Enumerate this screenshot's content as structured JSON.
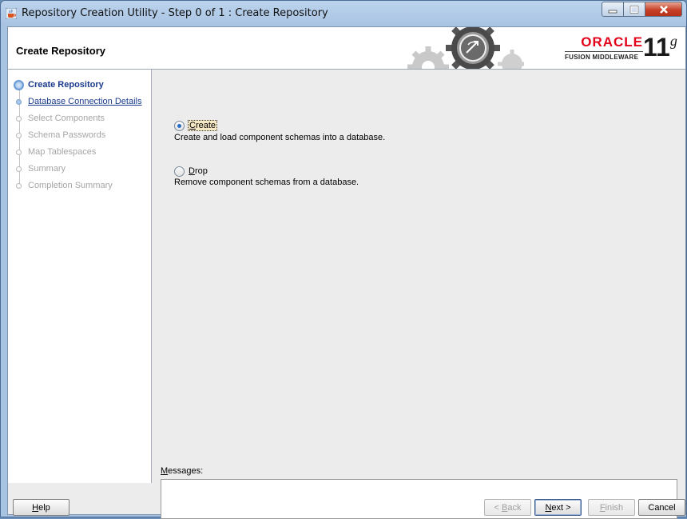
{
  "window": {
    "title": "Repository Creation Utility - Step 0 of 1 : Create Repository",
    "icon": "java-cup-icon"
  },
  "header": {
    "title": "Create Repository",
    "brand": {
      "oracle": "ORACLE",
      "product": "FUSION MIDDLEWARE",
      "version_number": "11",
      "version_letter": "g"
    }
  },
  "nav": {
    "items": [
      {
        "label": "Create Repository",
        "state": "current"
      },
      {
        "label": "Database Connection Details",
        "state": "link"
      },
      {
        "label": "Select Components",
        "state": "disabled"
      },
      {
        "label": "Schema Passwords",
        "state": "disabled"
      },
      {
        "label": "Map Tablespaces",
        "state": "disabled"
      },
      {
        "label": "Summary",
        "state": "disabled"
      },
      {
        "label": "Completion Summary",
        "state": "disabled"
      }
    ]
  },
  "options": {
    "create": {
      "label": "Create",
      "mnemonic": "C",
      "description": "Create and load component schemas into a database.",
      "selected": true
    },
    "drop": {
      "label": "Drop",
      "mnemonic": "D",
      "description": "Remove component schemas from a database.",
      "selected": false
    }
  },
  "messages": {
    "label": "Messages:",
    "mnemonic": "M",
    "text": ""
  },
  "footer": {
    "help": "Help",
    "back": "< Back",
    "next": "Next >",
    "finish": "Finish",
    "cancel": "Cancel"
  },
  "colors": {
    "oracle_red": "#e2001a",
    "nav_current": "#1a3a8c",
    "nav_disabled": "#a6a6a6",
    "radio_selected": "#2a6ec4"
  }
}
